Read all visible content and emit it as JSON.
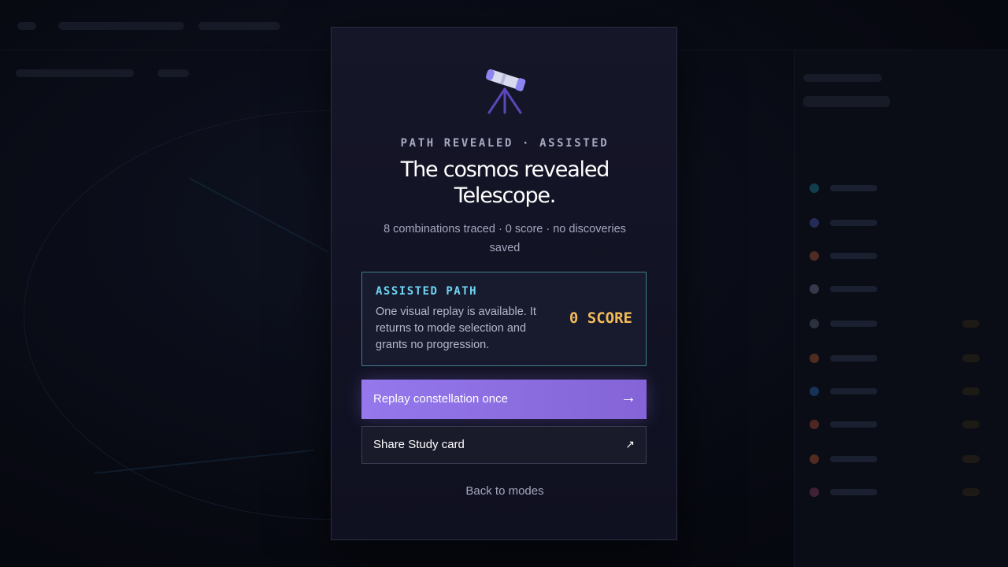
{
  "modal": {
    "icon": "telescope-icon",
    "eyebrow": "PATH REVEALED · ASSISTED",
    "title": "The cosmos revealed Telescope.",
    "subtitle": "8 combinations traced · 0 score · no discoveries saved",
    "assist": {
      "label": "ASSISTED PATH",
      "description": "One visual replay is available. It returns to mode selection and grants no progression.",
      "score": "0 SCORE"
    },
    "primary_button": {
      "label": "Replay constellation once",
      "icon": "→"
    },
    "secondary_button": {
      "label": "Share Study card",
      "icon": "↗"
    },
    "back_link": "Back to modes"
  },
  "colors": {
    "accent": "#9478ec",
    "assist_label": "#6fd6f4",
    "score": "#f2bb58",
    "modal_bg": "#151628"
  }
}
